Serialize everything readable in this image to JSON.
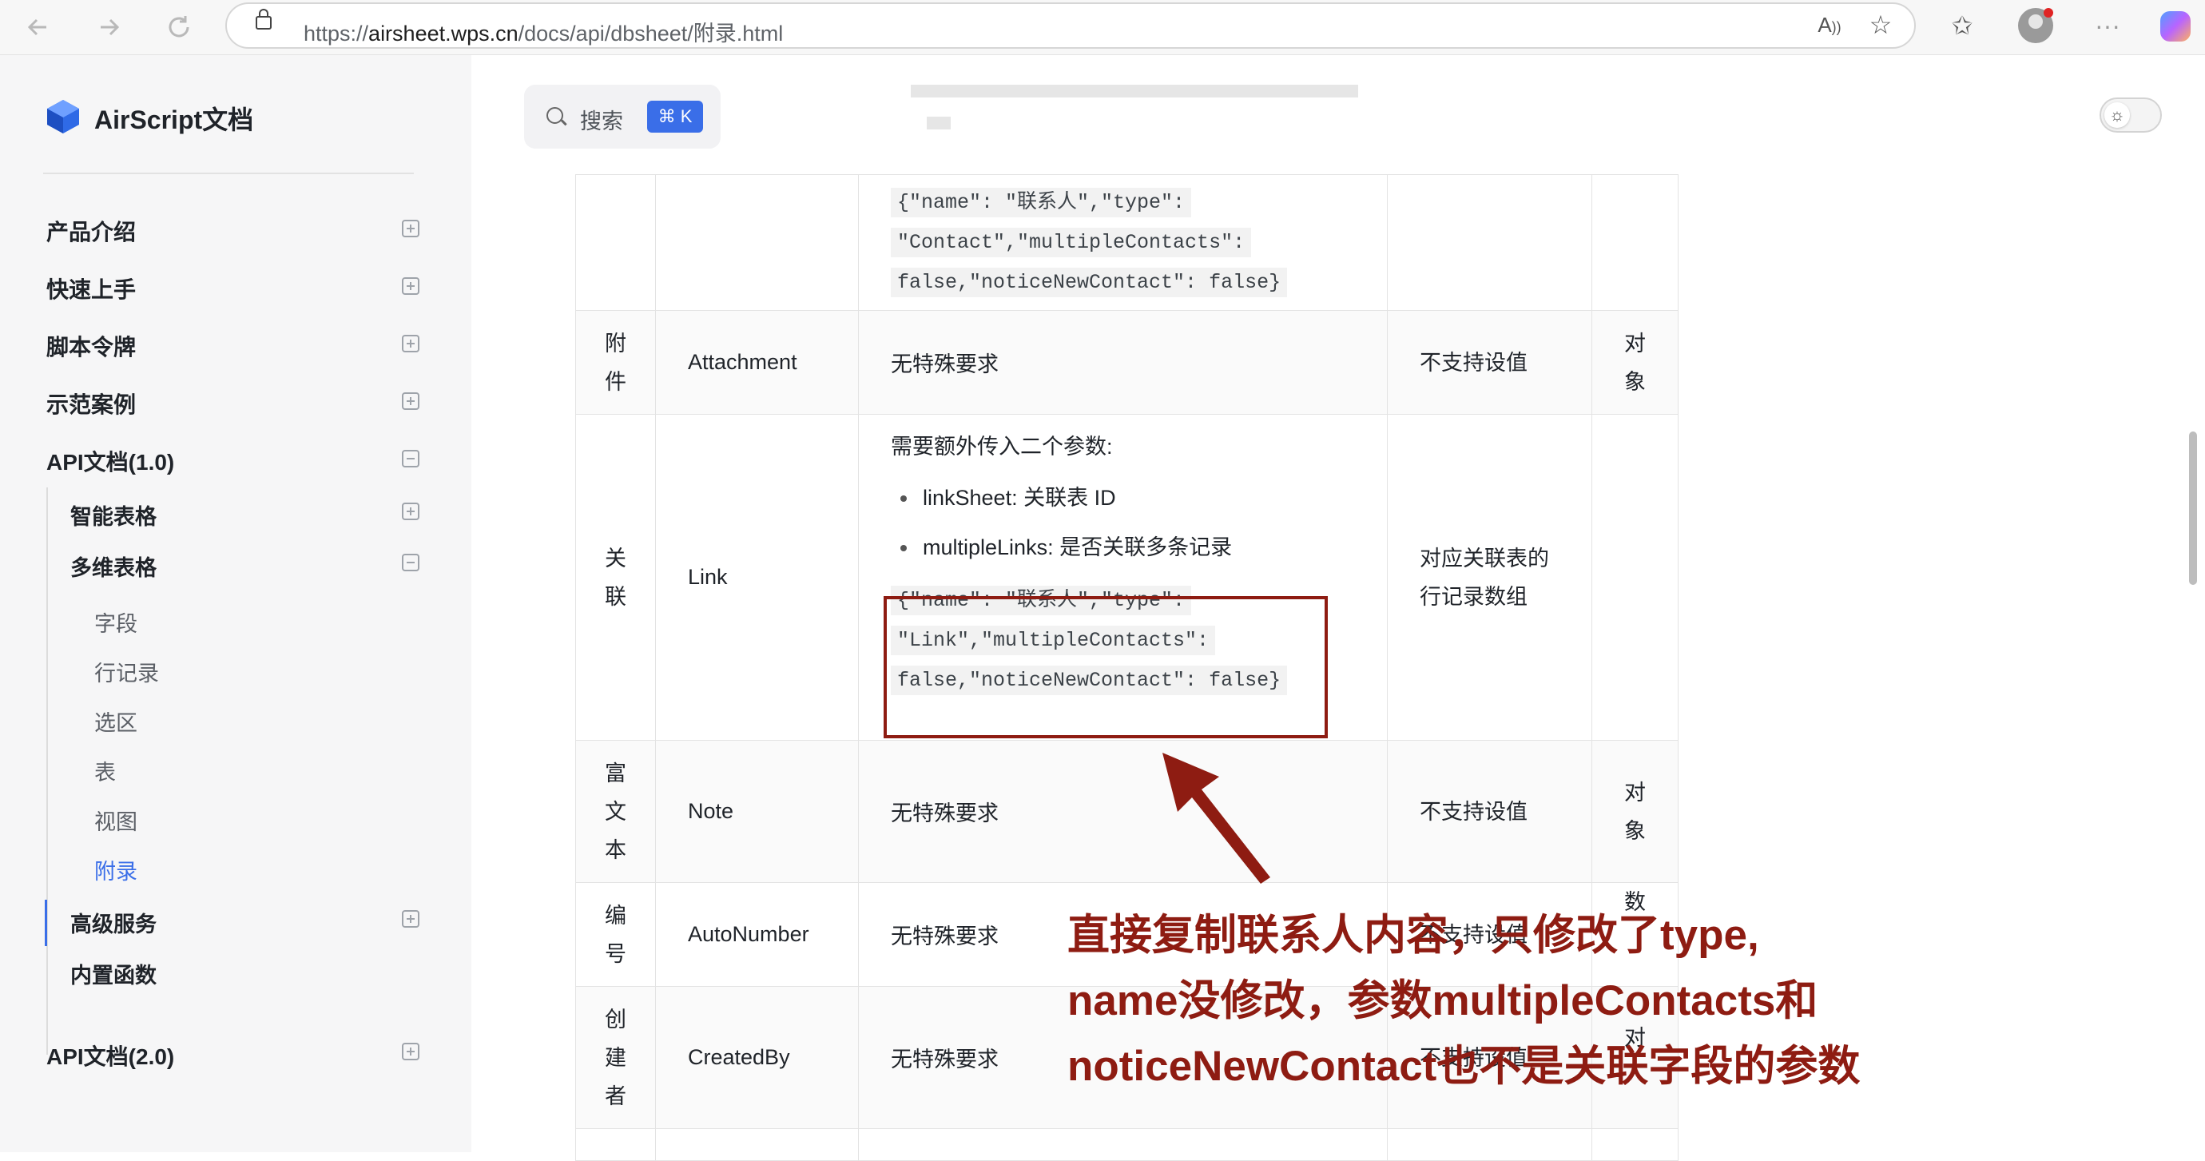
{
  "browser": {
    "url_prefix": "https://",
    "url_host": "airsheet.wps.cn",
    "url_path": "/docs/api/dbsheet/附录.html",
    "back_icon": "arrow-left-icon",
    "forward_icon": "arrow-right-icon",
    "reload_icon": "reload-icon",
    "read_aloud_icon": "read-aloud-icon",
    "favorite_icon": "star-icon",
    "favorites_icon": "favorites-icon",
    "more_icon": "more-icon"
  },
  "sidebar": {
    "brand": "AirScript文档",
    "items": [
      {
        "label": "产品介绍"
      },
      {
        "label": "快速上手"
      },
      {
        "label": "脚本令牌"
      },
      {
        "label": "示范案例"
      },
      {
        "label": "API文档(1.0)"
      }
    ],
    "api1_children": [
      {
        "label": "智能表格"
      },
      {
        "label": "多维表格"
      }
    ],
    "dbsheet_children": [
      {
        "label": "字段"
      },
      {
        "label": "行记录"
      },
      {
        "label": "选区"
      },
      {
        "label": "表"
      },
      {
        "label": "视图"
      },
      {
        "label": "附录"
      }
    ],
    "api1_more": [
      {
        "label": "高级服务"
      },
      {
        "label": "内置函数"
      }
    ],
    "api2": {
      "label": "API文档(2.0)"
    }
  },
  "search": {
    "label": "搜索",
    "shortcut": "⌘ K"
  },
  "table": {
    "top_code_lines": [
      "{\"name\": \"联系人\",\"type\":",
      "\"Contact\",\"multipleContacts\":",
      "false,\"noticeNewContact\": false}"
    ],
    "rows": [
      {
        "name_chars": [
          "附",
          "件"
        ],
        "type": "Attachment",
        "requirement": "无特殊要求",
        "set_value": "不支持设值",
        "return_chars": [
          "对",
          "象"
        ]
      },
      {
        "name_chars": [
          "关",
          "联"
        ],
        "type": "Link",
        "requirement_intro": "需要额外传入二个参数:",
        "bullets": [
          "linkSheet: 关联表 ID",
          "multipleLinks: 是否关联多条记录"
        ],
        "code_lines": [
          "{\"name\": \"联系人\",\"type\":",
          "\"Link\",\"multipleContacts\":",
          "false,\"noticeNewContact\": false}"
        ],
        "set_value_lines": [
          "对应关联表的",
          "行记录数组"
        ]
      },
      {
        "name_chars": [
          "富",
          "文",
          "本"
        ],
        "type": "Note",
        "requirement": "无特殊要求",
        "set_value": "不支持设值",
        "return_chars": [
          "对",
          "象"
        ]
      },
      {
        "name_chars": [
          "编",
          "号"
        ],
        "type": "AutoNumber",
        "requirement": "无特殊要求",
        "set_value": "不支持设值",
        "return_chars": [
          "数"
        ]
      },
      {
        "name_chars": [
          "创",
          "建",
          "者"
        ],
        "type": "CreatedBy",
        "requirement": "无特殊要求",
        "set_value": "不支持设值",
        "return_chars": [
          "对"
        ]
      }
    ]
  },
  "annotation": {
    "lines": [
      "直接复制联系人内容，只修改了type,",
      "name没修改，参数multipleContacts和",
      "noticeNewContact也不是关联字段的参数"
    ],
    "color": "#8e1c12"
  },
  "colors": {
    "accent": "#3a6ee8",
    "annotation": "#8e1c12"
  }
}
